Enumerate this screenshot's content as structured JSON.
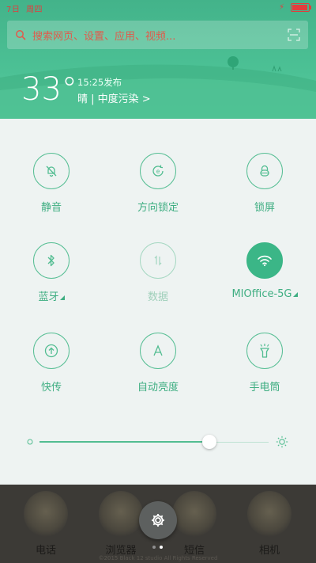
{
  "status_bar": {
    "date": "7日",
    "weekday": "周四",
    "battery_level_percent": 95,
    "charging": true,
    "color": "#e23d3d"
  },
  "search": {
    "placeholder": "搜索网页、设置、应用、视频..."
  },
  "weather": {
    "temperature": "33°",
    "publish_time": "15:25发布",
    "condition_line": "晴 | 中度污染 >"
  },
  "tiles": [
    {
      "key": "mute",
      "label": "静音",
      "icon": "bell-off-icon",
      "state": "off-outline"
    },
    {
      "key": "rotation-lock",
      "label": "方向锁定",
      "icon": "rotation-lock-icon",
      "state": "off-outline"
    },
    {
      "key": "lock-screen",
      "label": "锁屏",
      "icon": "lock-icon",
      "state": "off-outline"
    },
    {
      "key": "bluetooth",
      "label": "蓝牙",
      "icon": "bluetooth-icon",
      "state": "off-outline"
    },
    {
      "key": "mobile-data",
      "label": "数据",
      "icon": "data-arrows-icon",
      "state": "disabled"
    },
    {
      "key": "wifi",
      "label": "MIOffice-5G",
      "icon": "wifi-icon",
      "state": "on"
    },
    {
      "key": "quick-send",
      "label": "快传",
      "icon": "upload-icon",
      "state": "off-outline"
    },
    {
      "key": "auto-brightness",
      "label": "自动亮度",
      "icon": "letter-a-icon",
      "state": "off-outline"
    },
    {
      "key": "flashlight",
      "label": "手电筒",
      "icon": "flashlight-icon",
      "state": "off-outline"
    }
  ],
  "brightness": {
    "level": 0.74
  },
  "dock": {
    "apps": [
      {
        "label": "电话"
      },
      {
        "label": "浏览器"
      },
      {
        "label": "短信"
      },
      {
        "label": "相机"
      }
    ],
    "copyright": "©2015 Black 12 studio All Rights Reserved"
  },
  "colors": {
    "accent": "#3bb687",
    "header_green": "#4cc195",
    "panel_bg": "#eef3f2",
    "search_text": "#e25a4b"
  }
}
